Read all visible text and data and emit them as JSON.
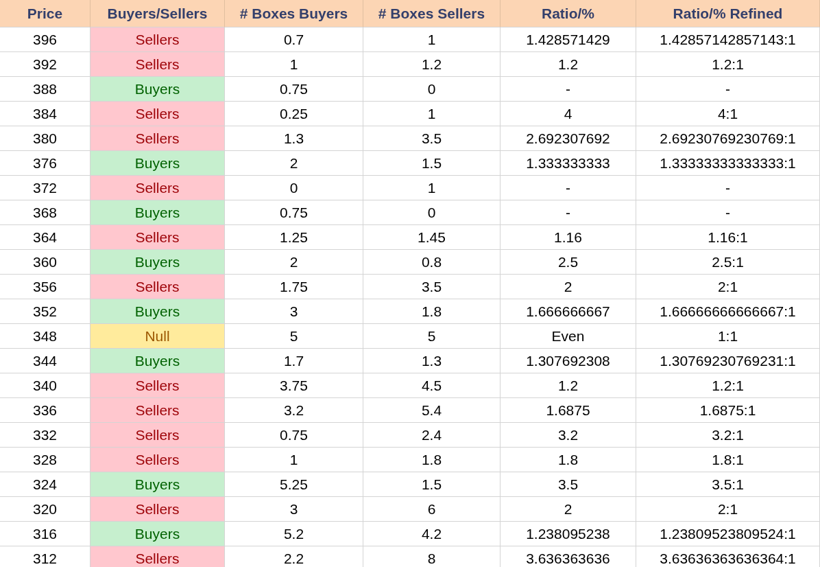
{
  "table": {
    "columns": [
      "Price",
      "Buyers/Sellers",
      "# Boxes Buyers",
      "# Boxes Sellers",
      "Ratio/%",
      "Ratio/% Refined"
    ],
    "rows": [
      {
        "price": "396",
        "side": "Sellers",
        "kind": "sellers",
        "buyers": "0.7",
        "sellers": "1",
        "ratio": "1.428571429",
        "refined": "1.42857142857143:1"
      },
      {
        "price": "392",
        "side": "Sellers",
        "kind": "sellers",
        "buyers": "1",
        "sellers": "1.2",
        "ratio": "1.2",
        "refined": "1.2:1"
      },
      {
        "price": "388",
        "side": "Buyers",
        "kind": "buyers",
        "buyers": "0.75",
        "sellers": "0",
        "ratio": "-",
        "refined": "-"
      },
      {
        "price": "384",
        "side": "Sellers",
        "kind": "sellers",
        "buyers": "0.25",
        "sellers": "1",
        "ratio": "4",
        "refined": "4:1"
      },
      {
        "price": "380",
        "side": "Sellers",
        "kind": "sellers",
        "buyers": "1.3",
        "sellers": "3.5",
        "ratio": "2.692307692",
        "refined": "2.69230769230769:1"
      },
      {
        "price": "376",
        "side": "Buyers",
        "kind": "buyers",
        "buyers": "2",
        "sellers": "1.5",
        "ratio": "1.333333333",
        "refined": "1.33333333333333:1"
      },
      {
        "price": "372",
        "side": "Sellers",
        "kind": "sellers",
        "buyers": "0",
        "sellers": "1",
        "ratio": "-",
        "refined": "-"
      },
      {
        "price": "368",
        "side": "Buyers",
        "kind": "buyers",
        "buyers": "0.75",
        "sellers": "0",
        "ratio": "-",
        "refined": "-"
      },
      {
        "price": "364",
        "side": "Sellers",
        "kind": "sellers",
        "buyers": "1.25",
        "sellers": "1.45",
        "ratio": "1.16",
        "refined": "1.16:1"
      },
      {
        "price": "360",
        "side": "Buyers",
        "kind": "buyers",
        "buyers": "2",
        "sellers": "0.8",
        "ratio": "2.5",
        "refined": "2.5:1"
      },
      {
        "price": "356",
        "side": "Sellers",
        "kind": "sellers",
        "buyers": "1.75",
        "sellers": "3.5",
        "ratio": "2",
        "refined": "2:1"
      },
      {
        "price": "352",
        "side": "Buyers",
        "kind": "buyers",
        "buyers": "3",
        "sellers": "1.8",
        "ratio": "1.666666667",
        "refined": "1.66666666666667:1"
      },
      {
        "price": "348",
        "side": "Null",
        "kind": "null",
        "buyers": "5",
        "sellers": "5",
        "ratio": "Even",
        "refined": "1:1"
      },
      {
        "price": "344",
        "side": "Buyers",
        "kind": "buyers",
        "buyers": "1.7",
        "sellers": "1.3",
        "ratio": "1.307692308",
        "refined": "1.30769230769231:1"
      },
      {
        "price": "340",
        "side": "Sellers",
        "kind": "sellers",
        "buyers": "3.75",
        "sellers": "4.5",
        "ratio": "1.2",
        "refined": "1.2:1"
      },
      {
        "price": "336",
        "side": "Sellers",
        "kind": "sellers",
        "buyers": "3.2",
        "sellers": "5.4",
        "ratio": "1.6875",
        "refined": "1.6875:1"
      },
      {
        "price": "332",
        "side": "Sellers",
        "kind": "sellers",
        "buyers": "0.75",
        "sellers": "2.4",
        "ratio": "3.2",
        "refined": "3.2:1"
      },
      {
        "price": "328",
        "side": "Sellers",
        "kind": "sellers",
        "buyers": "1",
        "sellers": "1.8",
        "ratio": "1.8",
        "refined": "1.8:1"
      },
      {
        "price": "324",
        "side": "Buyers",
        "kind": "buyers",
        "buyers": "5.25",
        "sellers": "1.5",
        "ratio": "3.5",
        "refined": "3.5:1"
      },
      {
        "price": "320",
        "side": "Sellers",
        "kind": "sellers",
        "buyers": "3",
        "sellers": "6",
        "ratio": "2",
        "refined": "2:1"
      },
      {
        "price": "316",
        "side": "Buyers",
        "kind": "buyers",
        "buyers": "5.2",
        "sellers": "4.2",
        "ratio": "1.238095238",
        "refined": "1.23809523809524:1"
      },
      {
        "price": "312",
        "side": "Sellers",
        "kind": "sellers",
        "buyers": "2.2",
        "sellers": "8",
        "ratio": "3.636363636",
        "refined": "3.63636363636364:1"
      }
    ]
  }
}
